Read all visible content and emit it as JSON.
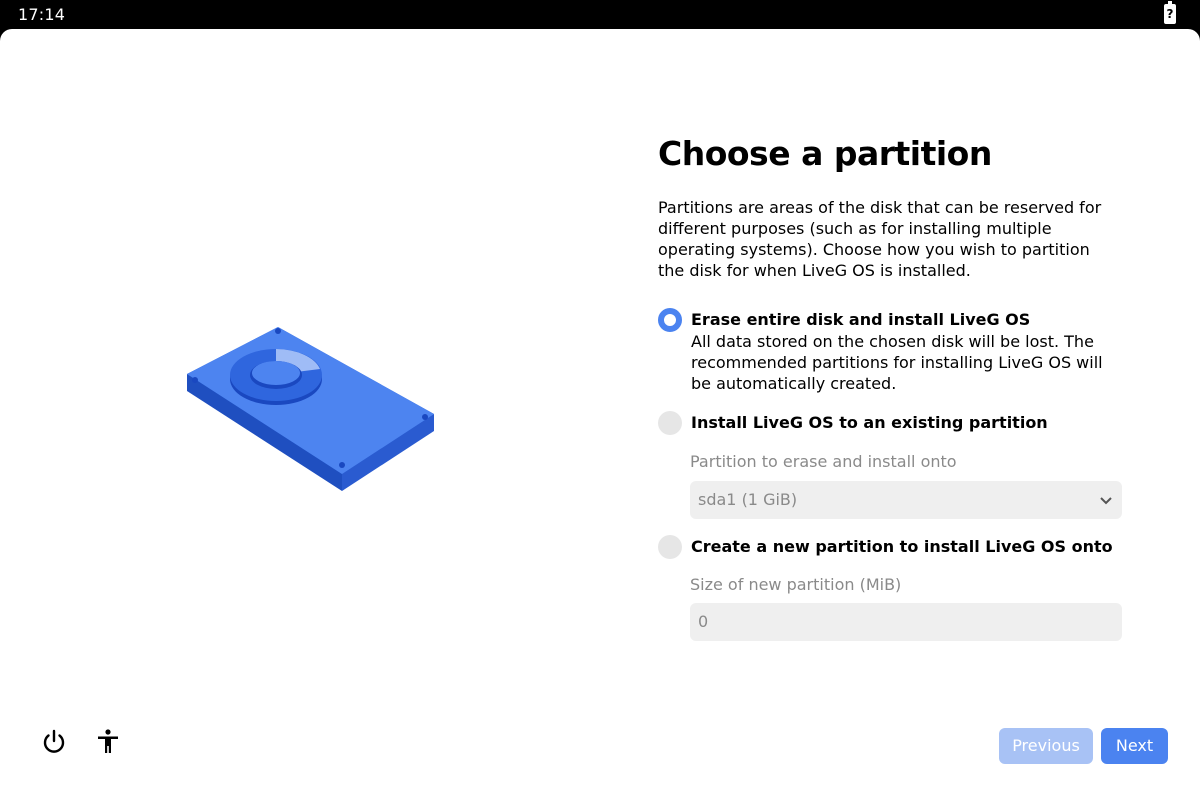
{
  "status": {
    "time": "17:14",
    "battery_glyph": "?"
  },
  "page": {
    "title": "Choose a partition",
    "description": "Partitions are areas of the disk that can be reserved for different purposes (such as for installing multiple operating systems). Choose how you wish to partition the disk for when LiveG OS is installed."
  },
  "options": [
    {
      "label": "Erase entire disk and install LiveG OS",
      "description": "All data stored on the chosen disk will be lost. The recommended partitions for installing LiveG OS will be automatically created.",
      "selected": true
    },
    {
      "label": "Install LiveG OS to an existing partition",
      "field_label": "Partition to erase and install onto",
      "field_value": "sda1 (1 GiB)",
      "selected": false
    },
    {
      "label": "Create a new partition to install LiveG OS onto",
      "field_label": "Size of new partition (MiB)",
      "field_value": "0",
      "selected": false
    }
  ],
  "footer": {
    "previous_label": "Previous",
    "next_label": "Next"
  },
  "icons": {
    "power": "power-icon",
    "accessibility": "accessibility-icon",
    "illustration": "hard-disk-illustration",
    "chevron": "chevron-down-icon"
  },
  "colors": {
    "accent": "#4b83f0",
    "accent_disabled": "#a8c2f5",
    "field_bg": "#efefef"
  }
}
